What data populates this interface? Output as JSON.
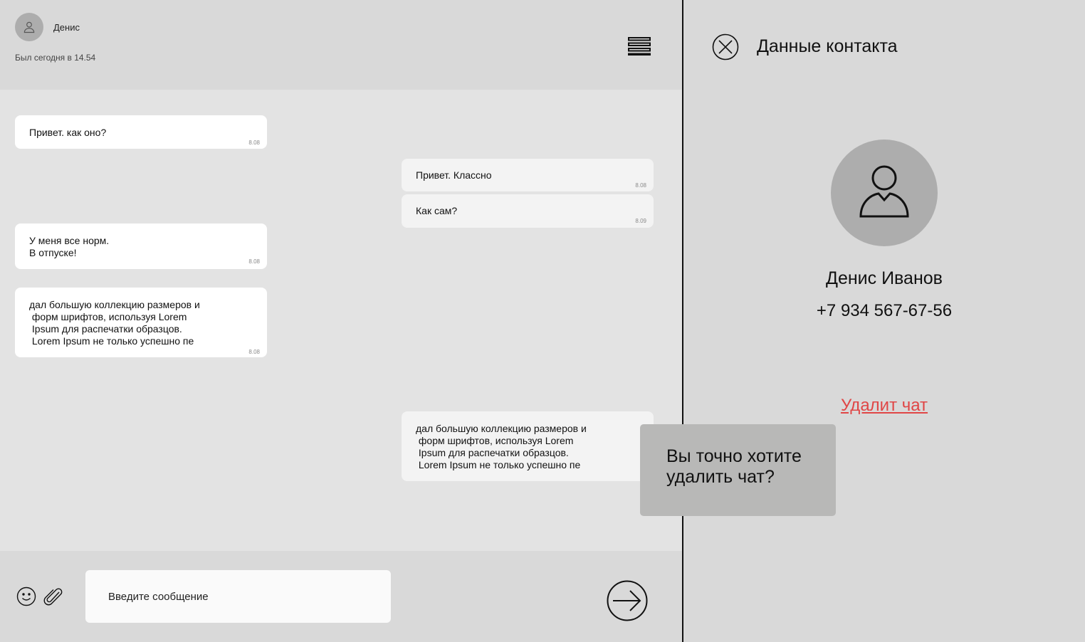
{
  "header": {
    "name": "Денис",
    "status": "Был сегодня в 14.54"
  },
  "messages": [
    {
      "dir": "in",
      "text": "Привет. как оно?",
      "time": "8.08"
    },
    {
      "dir": "out",
      "text": "Привет. Классно",
      "time": "8.08"
    },
    {
      "dir": "out",
      "text": "Как сам?",
      "time": "8.09"
    },
    {
      "dir": "in",
      "text": "У меня все норм.\nВ отпуске!",
      "time": "8.08"
    },
    {
      "dir": "in",
      "text": "дал большую коллекцию размеров и\n форм шрифтов, используя Lorem\n Ipsum для распечатки образцов.\n Lorem Ipsum не только успешно пе",
      "time": "8.08"
    },
    {
      "dir": "out",
      "text": "дал большую коллекцию размеров и\n форм шрифтов, используя Lorem\n Ipsum для распечатки образцов.\n Lorem Ipsum не только успешно пе",
      "time": ""
    }
  ],
  "composer": {
    "placeholder": "Введите сообщение"
  },
  "contact": {
    "title": "Данные контакта",
    "full_name": "Денис Иванов",
    "phone": "+7 934 567-67-56",
    "delete_label": "Удалит чат"
  },
  "confirm": {
    "question": "Вы точно хотите\nудалить чат?"
  },
  "icons": [
    "user-icon",
    "menu-icon",
    "emoji-icon",
    "paperclip-icon",
    "send-arrow-icon",
    "close-x-icon"
  ],
  "colors": {
    "delete_link": "#e04646",
    "panel_bg": "#d9d9d9",
    "chat_bg": "#e3e3e3",
    "avatar_bg": "#adadad",
    "dialog_bg": "#b8b8b7"
  }
}
